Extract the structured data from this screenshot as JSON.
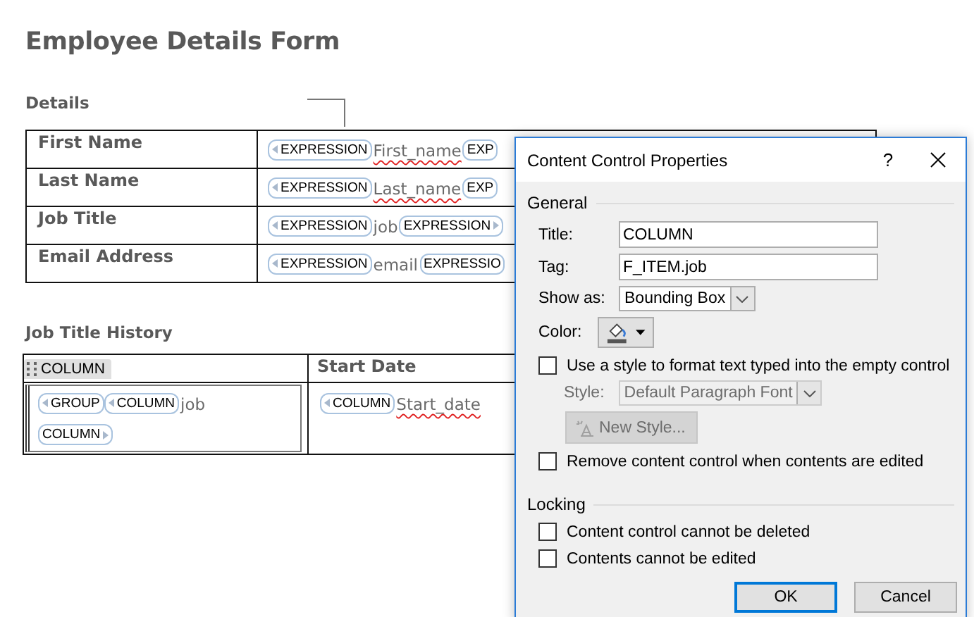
{
  "document": {
    "title": "Employee Details Form",
    "details": {
      "heading": "Details",
      "rows": [
        {
          "label": "First Name",
          "tokens": [
            {
              "kind": "tag",
              "text": "EXPRESSION",
              "start_arrow": true,
              "end_arrow": false
            },
            {
              "kind": "value",
              "text": "First_name",
              "misspelled": true
            },
            {
              "kind": "tag",
              "text": "EXP",
              "start_arrow": false,
              "end_arrow": false
            }
          ]
        },
        {
          "label": "Last Name",
          "tokens": [
            {
              "kind": "tag",
              "text": "EXPRESSION",
              "start_arrow": true,
              "end_arrow": false
            },
            {
              "kind": "value",
              "text": "Last_name",
              "misspelled": true
            },
            {
              "kind": "tag",
              "text": "EXP",
              "start_arrow": false,
              "end_arrow": false
            }
          ]
        },
        {
          "label": "Job Title",
          "tokens": [
            {
              "kind": "tag",
              "text": "EXPRESSION",
              "start_arrow": true,
              "end_arrow": false
            },
            {
              "kind": "value",
              "text": "job",
              "misspelled": false
            },
            {
              "kind": "tag",
              "text": "EXPRESSION",
              "start_arrow": false,
              "end_arrow": true
            }
          ]
        },
        {
          "label": "Email Address",
          "tokens": [
            {
              "kind": "tag",
              "text": "EXPRESSION",
              "start_arrow": true,
              "end_arrow": false
            },
            {
              "kind": "value",
              "text": "email",
              "misspelled": false
            },
            {
              "kind": "tag",
              "text": "EXPRESSIO",
              "start_arrow": false,
              "end_arrow": false
            }
          ]
        }
      ]
    },
    "history": {
      "heading": "Job Title History",
      "columns": [
        {
          "kind": "handle",
          "text": "COLUMN"
        },
        {
          "kind": "heading",
          "text": "Start Date"
        }
      ],
      "rows": [
        {
          "cells": [
            {
              "grouped": true,
              "tokens": [
                {
                  "kind": "tag",
                  "text": "GROUP",
                  "start_arrow": true,
                  "end_arrow": false
                },
                {
                  "kind": "tag",
                  "text": "COLUMN",
                  "start_arrow": true,
                  "end_arrow": false
                },
                {
                  "kind": "value",
                  "text": "job",
                  "misspelled": false
                },
                {
                  "kind": "break"
                },
                {
                  "kind": "tag",
                  "text": "COLUMN",
                  "start_arrow": false,
                  "end_arrow": true
                }
              ]
            },
            {
              "grouped": false,
              "tokens": [
                {
                  "kind": "tag",
                  "text": "COLUMN",
                  "start_arrow": true,
                  "end_arrow": false
                },
                {
                  "kind": "value",
                  "text": "Start_date",
                  "misspelled": true
                }
              ]
            }
          ]
        }
      ]
    }
  },
  "dialog": {
    "title": "Content Control Properties",
    "help": "?",
    "general": "General",
    "fields": [
      {
        "kind": "text",
        "label": "Title:",
        "value": "COLUMN"
      },
      {
        "kind": "text",
        "label": "Tag:",
        "value": "F_ITEM.job"
      },
      {
        "kind": "select",
        "label": "Show as:",
        "value": "Bounding Box"
      },
      {
        "kind": "color",
        "label": "Color:"
      }
    ],
    "use_style": {
      "label": "Use a style to format text typed into the empty control",
      "checked": false
    },
    "style": {
      "label": "Style:",
      "value": "Default Paragraph Font",
      "disabled": true
    },
    "new_style": {
      "label": "New Style...",
      "disabled": true
    },
    "remove": {
      "label": "Remove content control when contents are edited",
      "checked": false
    },
    "locking": "Locking",
    "lock_checks": [
      {
        "label": "Content control cannot be deleted",
        "checked": false
      },
      {
        "label": "Contents cannot be edited",
        "checked": false
      }
    ],
    "buttons": [
      {
        "label": "OK",
        "default": true
      },
      {
        "label": "Cancel",
        "default": false
      }
    ]
  }
}
